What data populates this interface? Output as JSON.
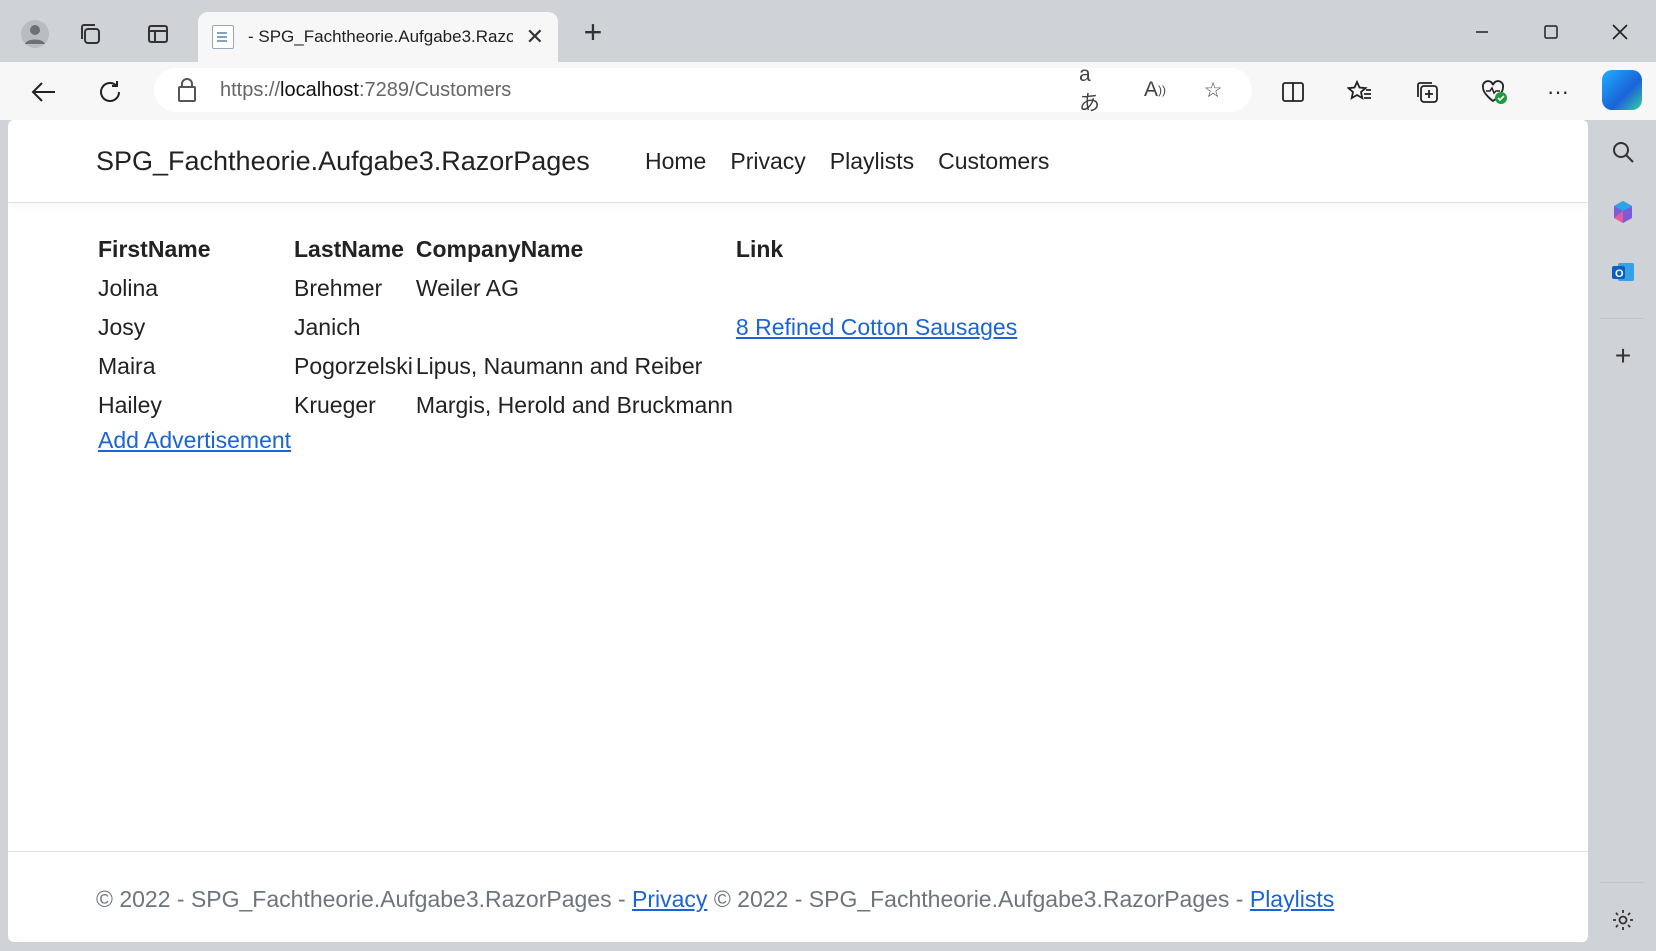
{
  "browser": {
    "tab_title": "- SPG_Fachtheorie.Aufgabe3.Razor",
    "url_scheme": "https://",
    "url_host": "localhost",
    "url_rest": ":7289/Customers"
  },
  "navbar": {
    "brand": "SPG_Fachtheorie.Aufgabe3.RazorPages",
    "links": [
      "Home",
      "Privacy",
      "Playlists",
      "Customers"
    ]
  },
  "table": {
    "headers": [
      "FirstName",
      "LastName",
      "CompanyName",
      "Link"
    ],
    "rows": [
      {
        "first": "Jolina",
        "last": "Brehmer",
        "company": "Weiler AG",
        "link": ""
      },
      {
        "first": "Josy",
        "last": "Janich",
        "company": "",
        "link": "8 Refined Cotton Sausages"
      },
      {
        "first": "Maira",
        "last": "Pogorzelski",
        "company": "Lipus, Naumann and Reiber",
        "link": ""
      },
      {
        "first": "Hailey",
        "last": "Krueger",
        "company": "Margis, Herold and Bruckmann",
        "link": ""
      }
    ]
  },
  "add_link": "Add Advertisement",
  "footer": {
    "text1": "© 2022 - SPG_Fachtheorie.Aufgabe3.RazorPages - ",
    "link1": "Privacy",
    "text2": " © 2022 - SPG_Fachtheorie.Aufgabe3.RazorPages - ",
    "link2": "Playlists"
  }
}
